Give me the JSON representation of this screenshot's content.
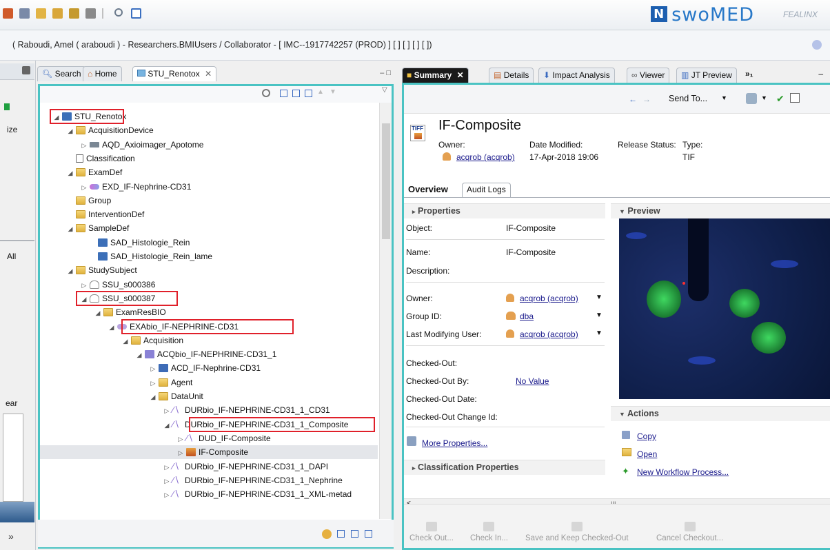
{
  "brand": {
    "name": "swoMED",
    "mark": "N",
    "partner": "FEALINX"
  },
  "userbar": {
    "text": "( Raboudi, Amel ( araboudi ) - Researchers.BMIUsers / Collaborator - [ IMC--1917742257 (PROD) ] [ ] [ ] [ ] [ ])"
  },
  "leftrail": {
    "labels": [
      "ize",
      "All",
      "ear"
    ]
  },
  "lefttabs": {
    "search": "Search",
    "home": "Home",
    "stu": "STU_Renotox"
  },
  "tree": [
    {
      "label": "STU_Renotox",
      "icon": "study",
      "twisty": "◢"
    },
    {
      "label": "AcquisitionDevice",
      "icon": "folder",
      "twisty": "◢"
    },
    {
      "label": "AQD_Axioimager_Apotome",
      "icon": "device",
      "twisty": "▷"
    },
    {
      "label": "Classification",
      "icon": "doc",
      "twisty": ""
    },
    {
      "label": "ExamDef",
      "icon": "folder",
      "twisty": "◢"
    },
    {
      "label": "EXD_IF-Nephrine-CD31",
      "icon": "exd",
      "twisty": "▷"
    },
    {
      "label": "Group",
      "icon": "folder",
      "twisty": ""
    },
    {
      "label": "InterventionDef",
      "icon": "folder",
      "twisty": ""
    },
    {
      "label": "SampleDef",
      "icon": "folder",
      "twisty": "◢"
    },
    {
      "label": "SAD_Histologie_Rein",
      "icon": "sad",
      "twisty": ""
    },
    {
      "label": "SAD_Histologie_Rein_lame",
      "icon": "sad",
      "twisty": ""
    },
    {
      "label": "StudySubject",
      "icon": "folder",
      "twisty": "◢"
    },
    {
      "label": "SSU_s000386",
      "icon": "user",
      "twisty": "▷"
    },
    {
      "label": "SSU_s000387",
      "icon": "user",
      "twisty": "◢"
    },
    {
      "label": "ExamResBIO",
      "icon": "folder",
      "twisty": "◢"
    },
    {
      "label": "EXAbio_IF-NEPHRINE-CD31",
      "icon": "eye",
      "twisty": "◢"
    },
    {
      "label": "Acquisition",
      "icon": "folder",
      "twisty": "◢"
    },
    {
      "label": "ACQbio_IF-NEPHRINE-CD31_1",
      "icon": "acq",
      "twisty": "◢"
    },
    {
      "label": "ACD_IF-Nephrine-CD31",
      "icon": "acd",
      "twisty": "▷"
    },
    {
      "label": "Agent",
      "icon": "folder",
      "twisty": "▷"
    },
    {
      "label": "DataUnit",
      "icon": "folder",
      "twisty": "◢"
    },
    {
      "label": "DURbio_IF-NEPHRINE-CD31_1_CD31",
      "icon": "wave",
      "twisty": "▷"
    },
    {
      "label": "DURbio_IF-NEPHRINE-CD31_1_Composite",
      "icon": "wave",
      "twisty": "◢"
    },
    {
      "label": "DUD_IF-Composite",
      "icon": "wave",
      "twisty": "▷"
    },
    {
      "label": "IF-Composite",
      "icon": "tif",
      "twisty": "▷"
    },
    {
      "label": "DURbio_IF-NEPHRINE-CD31_1_DAPI",
      "icon": "wave",
      "twisty": "▷"
    },
    {
      "label": "DURbio_IF-NEPHRINE-CD31_1_Nephrine",
      "icon": "wave",
      "twisty": "▷"
    },
    {
      "label": "DURbio_IF-NEPHRINE-CD31_1_XML-metad",
      "icon": "wave",
      "twisty": "▷"
    }
  ],
  "righttabs": {
    "summary": "Summary",
    "details": "Details",
    "impact": "Impact Analysis",
    "viewer": "Viewer",
    "jt": "JT Preview",
    "more": "»₁"
  },
  "sumtool": {
    "send_to": "Send To..."
  },
  "object": {
    "title": "IF-Composite",
    "file_badge": "TIFF",
    "owner_label": "Owner:",
    "owner_value": "acqrob (acqrob)",
    "date_label": "Date Modified:",
    "date_value": "17-Apr-2018 19:06",
    "release_label": "Release Status:",
    "type_label": "Type:",
    "type_value": "TIF"
  },
  "subtabs": {
    "overview": "Overview",
    "audit": "Audit Logs"
  },
  "properties": {
    "header": "Properties",
    "object_label": "Object:",
    "object_value": "IF-Composite",
    "name_label": "Name:",
    "name_value": "IF-Composite",
    "desc_label": "Description:",
    "owner_label": "Owner:",
    "owner_value": "acqrob (acqrob)",
    "group_label": "Group ID:",
    "group_value": "dba",
    "lmu_label": "Last Modifying User:",
    "lmu_value": "acqrob (acqrob)",
    "co_label": "Checked-Out:",
    "coby_label": "Checked-Out By:",
    "coby_value": "No Value",
    "codate_label": "Checked-Out Date:",
    "cochange_label": "Checked-Out Change Id:",
    "more": "More Properties..."
  },
  "classification": {
    "header": "Classification Properties"
  },
  "preview": {
    "header": "Preview"
  },
  "actions": {
    "header": "Actions",
    "copy": "Copy",
    "open": "Open",
    "workflow": "New Workflow Process..."
  },
  "bottom": {
    "checkout": "Check Out...",
    "checkin": "Check In...",
    "save_keep": "Save and Keep Checked-Out",
    "cancel": "Cancel Checkout..."
  }
}
